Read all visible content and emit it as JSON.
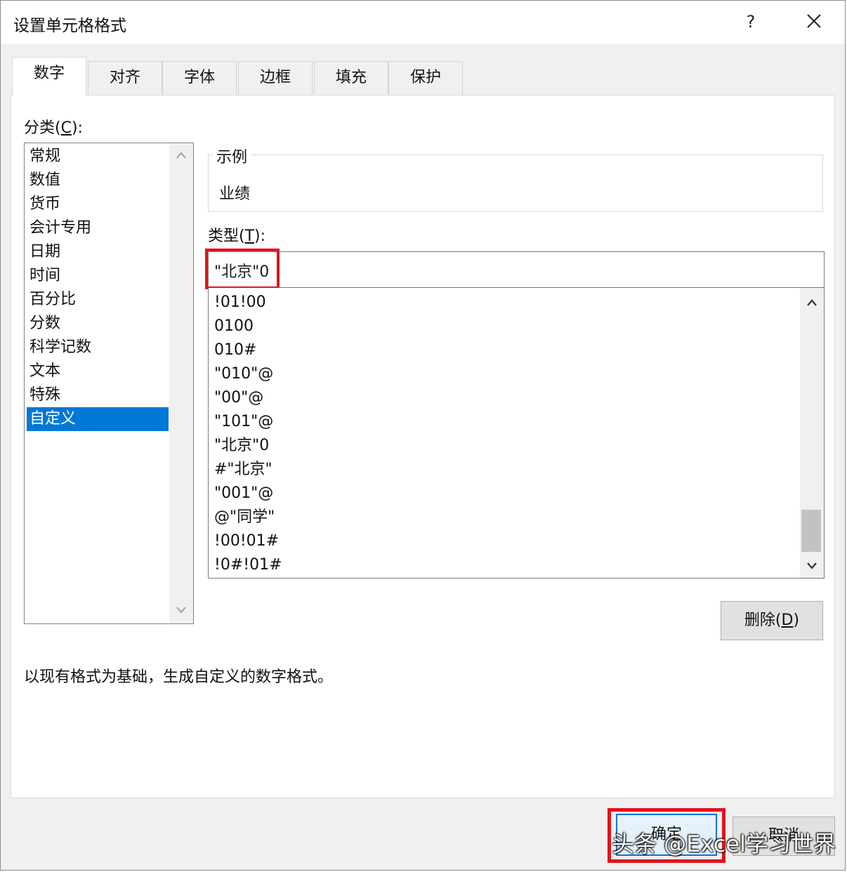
{
  "dialog": {
    "title": "设置单元格格式",
    "help_label": "?",
    "tabs": [
      {
        "label": "数字",
        "active": true
      },
      {
        "label": "对齐"
      },
      {
        "label": "字体"
      },
      {
        "label": "边框"
      },
      {
        "label": "填充"
      },
      {
        "label": "保护"
      }
    ]
  },
  "category": {
    "label_prefix": "分类(",
    "label_key": "C",
    "label_suffix": "):",
    "items": [
      "常规",
      "数值",
      "货币",
      "会计专用",
      "日期",
      "时间",
      "百分比",
      "分数",
      "科学记数",
      "文本",
      "特殊",
      "自定义"
    ],
    "selected": "自定义"
  },
  "sample": {
    "legend": "示例",
    "value": "业绩"
  },
  "type": {
    "label_prefix": "类型(",
    "label_key": "T",
    "label_suffix": "):",
    "input_value": "\"北京\"0",
    "formats": [
      "!01!00",
      "0100",
      "010#",
      "\"010\"@",
      "\"00\"@",
      "\"101\"@",
      "\"北京\"0",
      "#\"北京\"",
      "\"001\"@",
      "@\"同学\"",
      "!00!01#",
      "!0#!01#"
    ]
  },
  "delete_button": {
    "prefix": "删除(",
    "key": "D",
    "suffix": ")"
  },
  "description": "以现有格式为基础，生成自定义的数字格式。",
  "footer": {
    "ok_label": "确定",
    "cancel_label": "取消"
  },
  "watermark": "头条 @Excel学习世界",
  "colors": {
    "highlight": "#e0141e",
    "selection": "#0078d7"
  }
}
